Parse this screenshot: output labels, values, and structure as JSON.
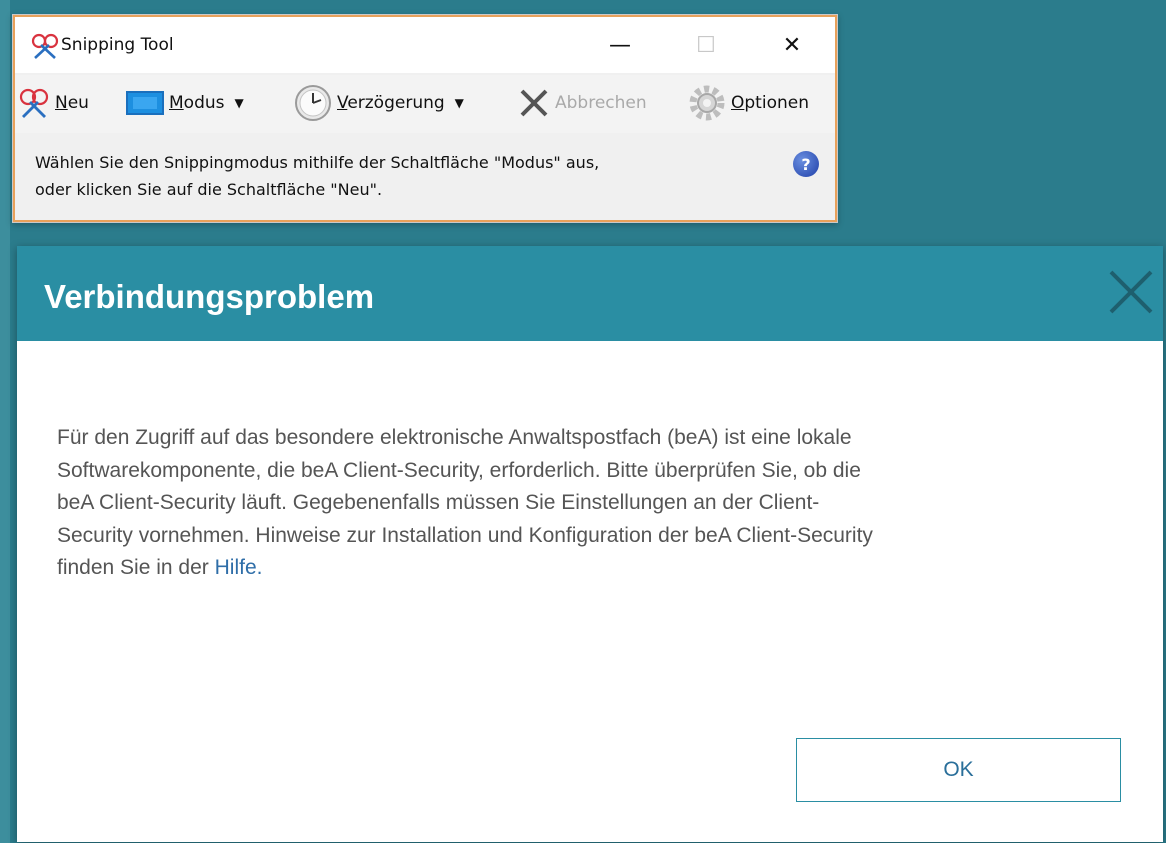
{
  "colors": {
    "backdrop": "#2b7c8c",
    "dialog_header": "#2a8ea3",
    "link": "#2f6ea8",
    "body_text": "#555555"
  },
  "snipping_tool": {
    "title": "Snipping Tool",
    "icon": "scissors-icon",
    "window_controls": {
      "minimize": "—",
      "maximize": "☐",
      "close": "✕"
    },
    "toolbar": {
      "new_accesskey": "N",
      "new_rest": "eu",
      "mode_accesskey": "M",
      "mode_rest": "odus",
      "delay_accesskey": "V",
      "delay_rest": "erzögerung",
      "cancel_label": "Abbrechen",
      "options_accesskey": "O",
      "options_rest": "ptionen"
    },
    "message_line1": "Wählen Sie den Snippingmodus mithilfe der Schaltfläche \"Modus\" aus,",
    "message_line2": "oder klicken Sie auf die Schaltfläche \"Neu\".",
    "help_glyph": "?"
  },
  "dialog": {
    "title": "Verbindungsproblem",
    "body_line1": "Für den Zugriff auf das besondere elektronische Anwaltspostfach (beA) ist eine lokale",
    "body_line2": "Softwarekomponente, die beA Client-Security, erforderlich. Bitte überprüfen Sie, ob die",
    "body_line3": "beA Client-Security läuft. Gegebenenfalls müssen Sie Einstellungen an der Client-",
    "body_line4": "Security vornehmen. Hinweise zur Installation und Konfiguration der beA Client-Security",
    "body_line5_prefix": "finden Sie in der ",
    "help_link": "Hilfe.",
    "ok_label": "OK"
  }
}
